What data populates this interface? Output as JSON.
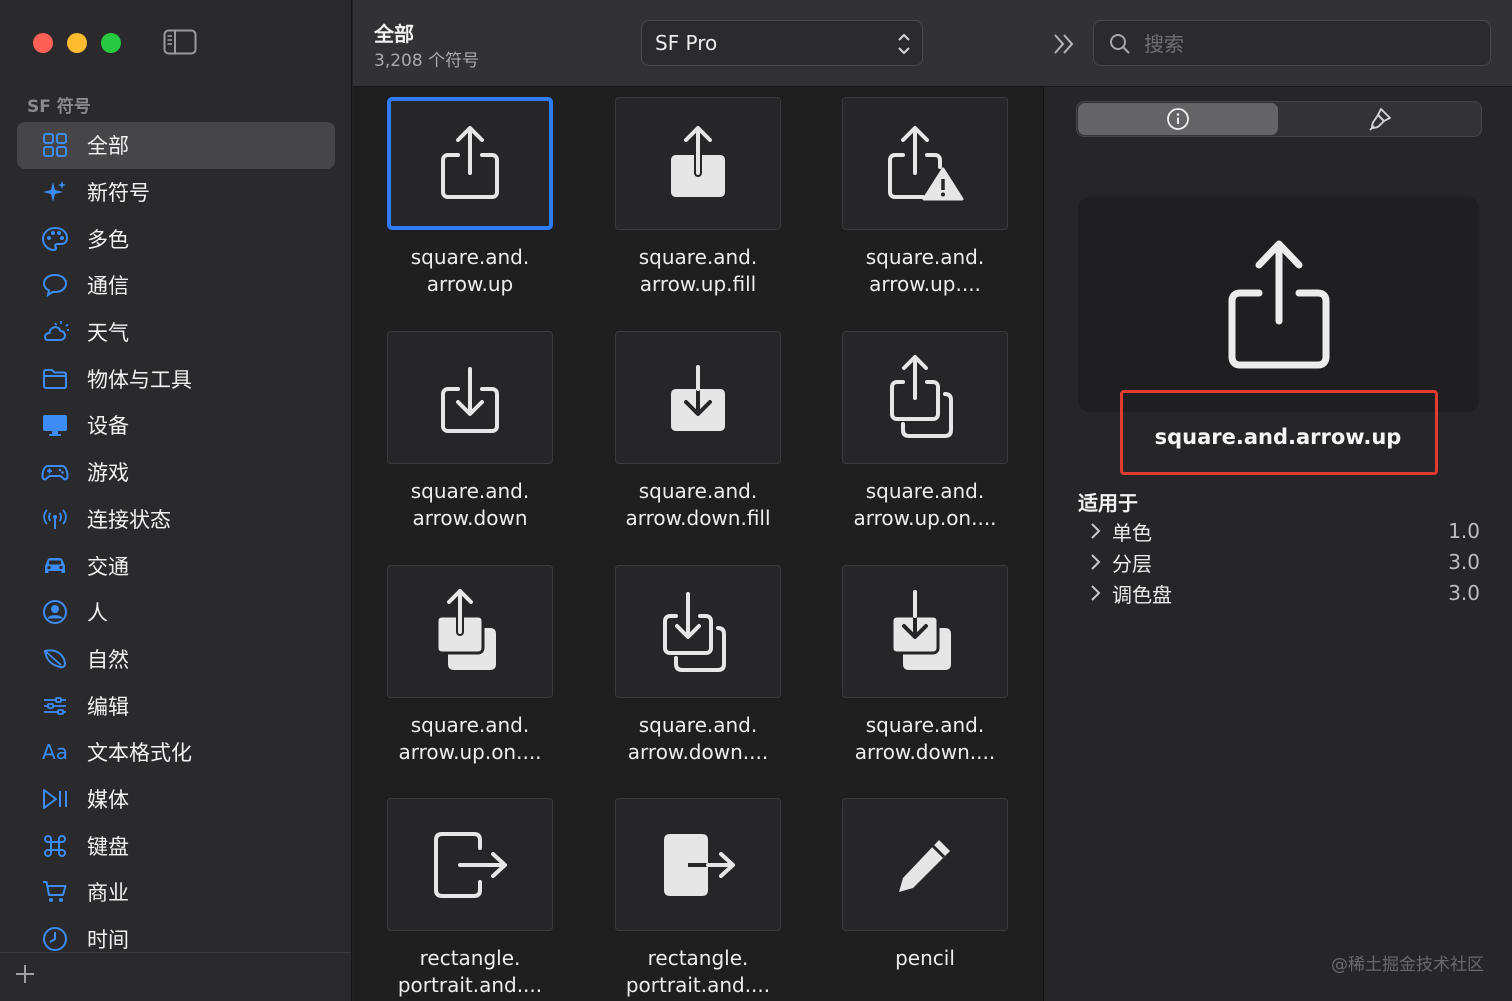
{
  "sidebar": {
    "section_title": "SF 符号",
    "items": [
      {
        "label": "全部",
        "icon": "grid-icon",
        "active": true
      },
      {
        "label": "新符号",
        "icon": "sparkles-icon"
      },
      {
        "label": "多色",
        "icon": "palette-icon"
      },
      {
        "label": "通信",
        "icon": "message-bubble-icon"
      },
      {
        "label": "天气",
        "icon": "cloud-sun-icon"
      },
      {
        "label": "物体与工具",
        "icon": "folder-icon"
      },
      {
        "label": "设备",
        "icon": "desktop-icon"
      },
      {
        "label": "游戏",
        "icon": "gamecontroller-icon"
      },
      {
        "label": "连接状态",
        "icon": "antenna-icon"
      },
      {
        "label": "交通",
        "icon": "car-icon"
      },
      {
        "label": "人",
        "icon": "person-circle-icon"
      },
      {
        "label": "自然",
        "icon": "leaf-icon"
      },
      {
        "label": "编辑",
        "icon": "sliders-icon"
      },
      {
        "label": "文本格式化",
        "icon": "textformat-icon",
        "glyph": "Aa"
      },
      {
        "label": "媒体",
        "icon": "playpause-icon"
      },
      {
        "label": "键盘",
        "icon": "command-icon"
      },
      {
        "label": "商业",
        "icon": "cart-icon"
      },
      {
        "label": "时间",
        "icon": "clock-icon"
      }
    ]
  },
  "toolbar": {
    "title": "全部",
    "subtitle": "3,208 个符号",
    "font_select_value": "SF Pro",
    "search_placeholder": "搜索"
  },
  "grid": {
    "symbols": [
      {
        "label": "square.and.\narrow.up",
        "icon": "square-and-arrow-up-icon",
        "selected": true
      },
      {
        "label": "square.and.\narrow.up.fill",
        "icon": "square-and-arrow-up-fill-icon"
      },
      {
        "label": "square.and.\narrow.up....",
        "icon": "square-and-arrow-up-trianglebadge-icon"
      },
      {
        "label": "square.and.\narrow.down",
        "icon": "square-and-arrow-down-icon"
      },
      {
        "label": "square.and.\narrow.down.fill",
        "icon": "square-and-arrow-down-fill-icon"
      },
      {
        "label": "square.and.\narrow.up.on....",
        "icon": "square-and-arrow-up-on-square-icon"
      },
      {
        "label": "square.and.\narrow.up.on....",
        "icon": "square-and-arrow-up-on-square-fill-icon"
      },
      {
        "label": "square.and.\narrow.down....",
        "icon": "square-and-arrow-down-on-square-icon"
      },
      {
        "label": "square.and.\narrow.down....",
        "icon": "square-and-arrow-down-on-square-fill-icon"
      },
      {
        "label": "rectangle.\nportrait.and....",
        "icon": "rectangle-portrait-and-arrow-right-icon"
      },
      {
        "label": "rectangle.\nportrait.and....",
        "icon": "rectangle-portrait-and-arrow-right-fill-icon"
      },
      {
        "label": "pencil",
        "icon": "pencil-icon"
      }
    ]
  },
  "inspector": {
    "symbol_name": "square.and.arrow.up",
    "availability_title": "适用于",
    "availability": [
      {
        "name": "单色",
        "version": "1.0"
      },
      {
        "name": "分层",
        "version": "3.0"
      },
      {
        "name": "调色盘",
        "version": "3.0"
      }
    ],
    "watermark": "@稀土掘金技术社区"
  },
  "colors": {
    "accent": "#2f7bf5",
    "highlight_box": "#e23b30",
    "sidebar_icon": "#3d8cf5"
  }
}
